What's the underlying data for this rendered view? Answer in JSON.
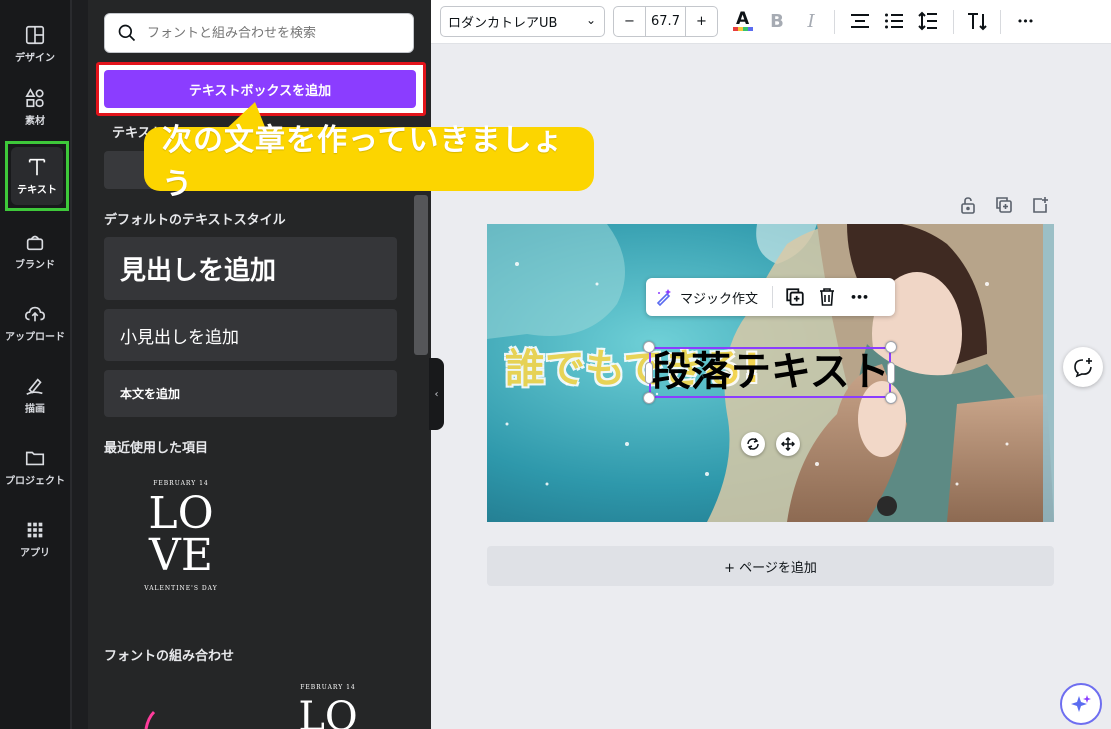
{
  "rail": {
    "items": [
      {
        "label": "デザイン",
        "icon": "layout-icon"
      },
      {
        "label": "素材",
        "icon": "shapes-icon"
      },
      {
        "label": "テキスト",
        "icon": "text-icon"
      },
      {
        "label": "ブランド",
        "icon": "brand-icon"
      },
      {
        "label": "アップロード",
        "icon": "upload-icon"
      },
      {
        "label": "描画",
        "icon": "draw-icon"
      },
      {
        "label": "プロジェクト",
        "icon": "folder-icon"
      },
      {
        "label": "アプリ",
        "icon": "apps-icon"
      }
    ]
  },
  "panel": {
    "search_placeholder": "フォントと組み合わせを検索",
    "add_textbox": "テキストボックスを追加",
    "partial_heading": "テキスト",
    "default_styles_title": "デフォルトのテキストスタイル",
    "heading": "見出しを追加",
    "subheading": "小見出しを追加",
    "body": "本文を追加",
    "recent_title": "最近使用した項目",
    "recent_love": {
      "top": "FEBRUARY 14",
      "line1": "LO",
      "line2": "VE",
      "bottom": "VALENTINE'S DAY"
    },
    "combos_title": "フォントの組み合わせ",
    "combo_love": {
      "top": "FEBRUARY 14",
      "big": "LO"
    }
  },
  "toolbar": {
    "font_name": "ロダンカトレアUB",
    "minus": "−",
    "font_size": "67.7",
    "plus": "+",
    "bold": "B",
    "italic": "I",
    "more": "•••"
  },
  "callout": {
    "text": "次の文章を作っていきましょう"
  },
  "floating_bar": {
    "magic": "マジック作文"
  },
  "canvas": {
    "headline": "誰でもできる!",
    "selected_text": "段落テキスト",
    "add_page": "+ ページを追加"
  },
  "colors": {
    "accent": "#8b3dff",
    "highlight_green": "#3ec83a",
    "highlight_red": "#e3141b",
    "callout": "#fcd500"
  }
}
